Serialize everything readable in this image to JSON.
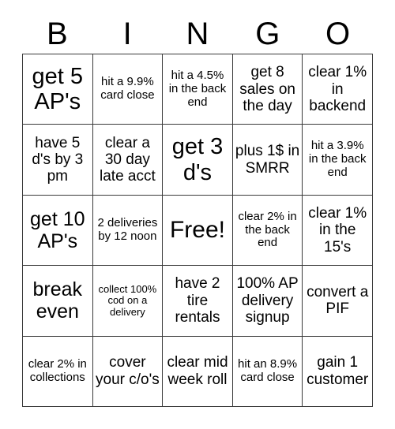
{
  "card": {
    "title": "BINGO",
    "header_letters": [
      "B",
      "I",
      "N",
      "G",
      "O"
    ],
    "free_space": "Free!",
    "border_color": "#3a3a3a",
    "background_color": "#ffffff",
    "text_color": "#000000",
    "rows": 5,
    "columns": 5
  },
  "grid": [
    [
      {
        "text": "get 5 AP's",
        "size": "sz-xl"
      },
      {
        "text": "hit a 9.9% card close",
        "size": "sz-sm"
      },
      {
        "text": "hit a 4.5% in the back end",
        "size": "sz-sm"
      },
      {
        "text": "get 8 sales on the day",
        "size": "sz-md"
      },
      {
        "text": "clear 1% in backend",
        "size": "sz-md"
      }
    ],
    [
      {
        "text": "have 5 d's by 3 pm",
        "size": "sz-md"
      },
      {
        "text": "clear a 30 day late acct",
        "size": "sz-md"
      },
      {
        "text": "get 3 d's",
        "size": "sz-xl"
      },
      {
        "text": "plus 1$ in SMRR",
        "size": "sz-md"
      },
      {
        "text": "hit a 3.9% in the back end",
        "size": "sz-sm"
      }
    ],
    [
      {
        "text": "get 10 AP's",
        "size": "sz-lg"
      },
      {
        "text": "2 deliveries by 12 noon",
        "size": "sz-sm"
      },
      {
        "text": "Free!",
        "size": "sz-free"
      },
      {
        "text": "clear 2% in the back end",
        "size": "sz-sm"
      },
      {
        "text": "clear 1% in the 15's",
        "size": "sz-md"
      }
    ],
    [
      {
        "text": "break even",
        "size": "sz-lg"
      },
      {
        "text": "collect 100% cod on a delivery",
        "size": "sz-xs"
      },
      {
        "text": "have 2 tire rentals",
        "size": "sz-md"
      },
      {
        "text": "100% AP delivery signup",
        "size": "sz-md"
      },
      {
        "text": "convert a PIF",
        "size": "sz-md"
      }
    ],
    [
      {
        "text": "clear 2% in collections",
        "size": "sz-sm"
      },
      {
        "text": "cover your c/o's",
        "size": "sz-md"
      },
      {
        "text": "clear mid week roll",
        "size": "sz-md"
      },
      {
        "text": "hit an 8.9% card close",
        "size": "sz-sm"
      },
      {
        "text": "gain 1 customer",
        "size": "sz-md"
      }
    ]
  ]
}
